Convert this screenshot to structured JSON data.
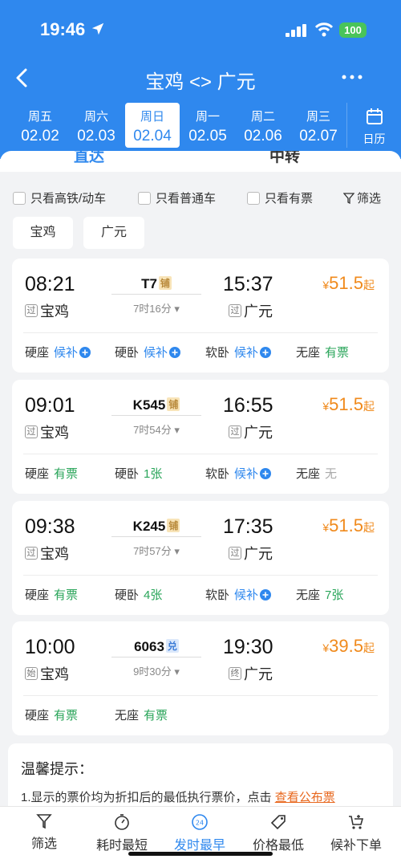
{
  "status": {
    "time": "19:46",
    "battery": "100"
  },
  "nav": {
    "title": "宝鸡 <> 广元"
  },
  "dates": [
    {
      "weekday": "周五",
      "date": "02.02"
    },
    {
      "weekday": "周六",
      "date": "02.03"
    },
    {
      "weekday": "周日",
      "date": "02.04"
    },
    {
      "weekday": "周一",
      "date": "02.05"
    },
    {
      "weekday": "周二",
      "date": "02.06"
    },
    {
      "weekday": "周三",
      "date": "02.07"
    }
  ],
  "calendar_label": "日历",
  "tabs": [
    "直达",
    "中转"
  ],
  "filters": [
    "只看高铁/动车",
    "只看普通车",
    "只看有票"
  ],
  "filter_label": "筛选",
  "stations": [
    "宝鸡",
    "广元"
  ],
  "trains": [
    {
      "dep_time": "08:21",
      "dep_tag": "过",
      "dep_station": "宝鸡",
      "number": "T7",
      "tag": "铺",
      "duration": "7时16分",
      "arr_time": "15:37",
      "arr_tag": "过",
      "arr_station": "广元",
      "price_sym": "¥",
      "price": "51.5",
      "price_suffix": "起",
      "seats": [
        {
          "name": "硬座",
          "value": "候补"
        },
        {
          "name": "硬卧",
          "value": "候补"
        },
        {
          "name": "软卧",
          "value": "候补"
        },
        {
          "name": "无座",
          "value": "有票"
        }
      ]
    },
    {
      "dep_time": "09:01",
      "dep_tag": "过",
      "dep_station": "宝鸡",
      "number": "K545",
      "tag": "铺",
      "duration": "7时54分",
      "arr_time": "16:55",
      "arr_tag": "过",
      "arr_station": "广元",
      "price_sym": "¥",
      "price": "51.5",
      "price_suffix": "起",
      "seats": [
        {
          "name": "硬座",
          "value": "有票"
        },
        {
          "name": "硬卧",
          "value": "1张"
        },
        {
          "name": "软卧",
          "value": "候补"
        },
        {
          "name": "无座",
          "value": "无"
        }
      ]
    },
    {
      "dep_time": "09:38",
      "dep_tag": "过",
      "dep_station": "宝鸡",
      "number": "K245",
      "tag": "铺",
      "duration": "7时57分",
      "arr_time": "17:35",
      "arr_tag": "过",
      "arr_station": "广元",
      "price_sym": "¥",
      "price": "51.5",
      "price_suffix": "起",
      "seats": [
        {
          "name": "硬座",
          "value": "有票"
        },
        {
          "name": "硬卧",
          "value": "4张"
        },
        {
          "name": "软卧",
          "value": "候补"
        },
        {
          "name": "无座",
          "value": "7张"
        }
      ]
    },
    {
      "dep_time": "10:00",
      "dep_tag": "始",
      "dep_station": "宝鸡",
      "number": "6063",
      "tag": "兑",
      "duration": "9时30分",
      "arr_time": "19:30",
      "arr_tag": "终",
      "arr_station": "广元",
      "price_sym": "¥",
      "price": "39.5",
      "price_suffix": "起",
      "seats": [
        {
          "name": "硬座",
          "value": "有票"
        },
        {
          "name": "无座",
          "value": "有票"
        }
      ]
    }
  ],
  "notice": {
    "title": "温馨提示：",
    "body": "1.显示的票价均为折扣后的最低执行票价，点击 ",
    "link": "查看公布票"
  },
  "bottom": [
    "筛选",
    "耗时最短",
    "发时最早",
    "价格最低",
    "候补下单"
  ],
  "colors": {
    "primary": "#2f88ee",
    "price": "#f08a1c",
    "available": "#2aa55a"
  }
}
